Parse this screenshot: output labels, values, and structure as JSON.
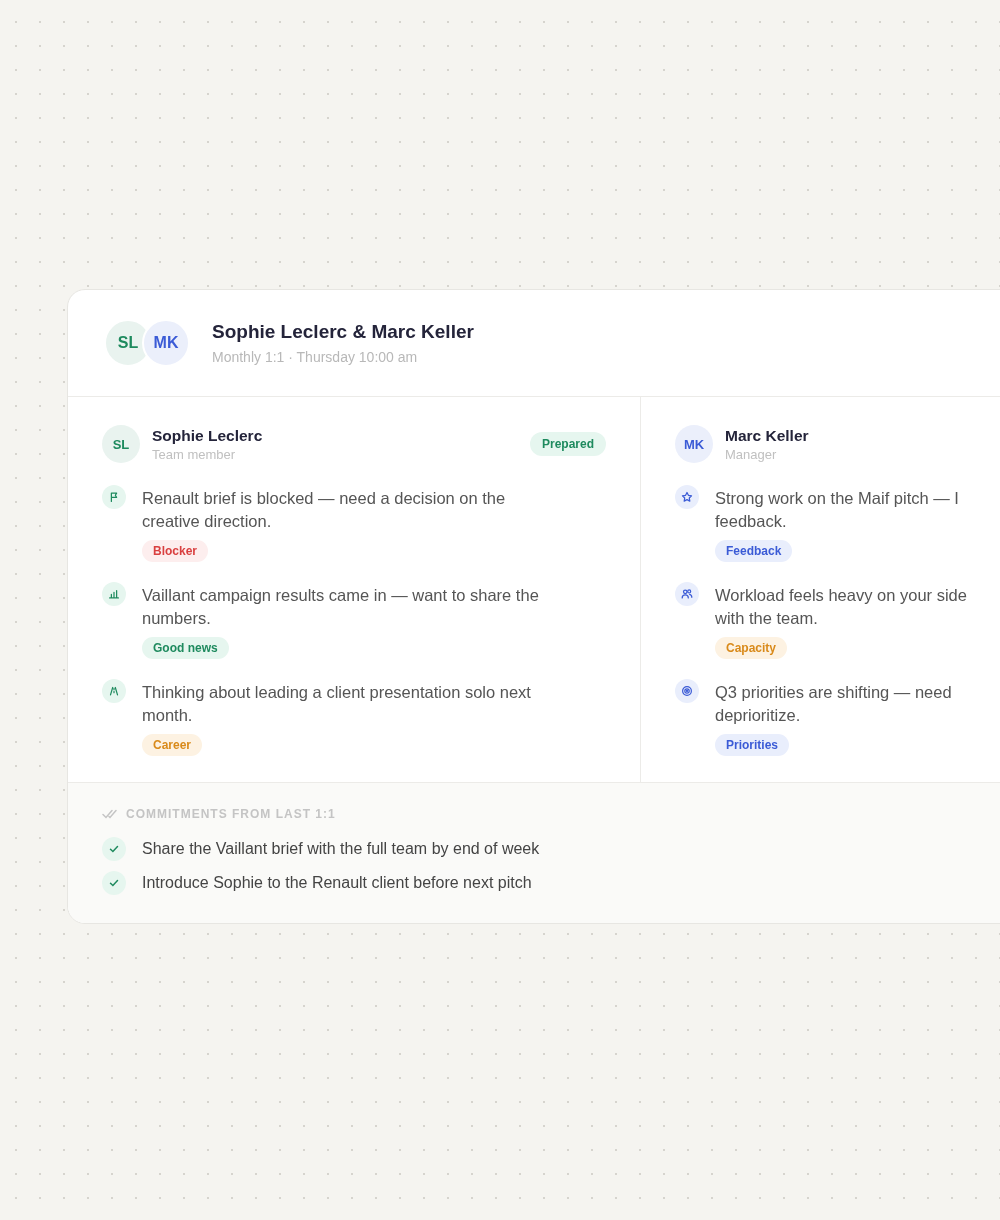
{
  "header": {
    "avatars": [
      {
        "initials": "SL",
        "color": "#1e8a5e"
      },
      {
        "initials": "MK",
        "color": "#3b5bd6"
      }
    ],
    "title": "Sophie Leclerc & Marc Keller",
    "subtitle": "Monthly 1:1 · Thursday 10:00 am"
  },
  "columns": [
    {
      "initials": "SL",
      "color": "#1e8a5e",
      "name": "Sophie Leclerc",
      "role": "Team member",
      "status": "Prepared",
      "items": [
        {
          "kind": "blocker",
          "lines": [
            "Renault brief is blocked — need a decision on the",
            "creative direction."
          ],
          "tag": "Blocker"
        },
        {
          "kind": "good-news",
          "lines": [
            "Vaillant campaign results came in — want to share the",
            "numbers."
          ],
          "tag": "Good news"
        },
        {
          "kind": "career",
          "lines": [
            "Thinking about leading a client presentation solo next",
            "month."
          ],
          "tag": "Career"
        }
      ]
    },
    {
      "initials": "MK",
      "color": "#3b5bd6",
      "name": "Marc Keller",
      "role": "Manager",
      "items": [
        {
          "kind": "feedback",
          "lines": [
            "Strong work on the Maif pitch — I",
            "feedback."
          ],
          "tag": "Feedback"
        },
        {
          "kind": "capacity",
          "lines": [
            "Workload feels heavy on your side",
            "with the team."
          ],
          "tag": "Capacity"
        },
        {
          "kind": "priorities",
          "lines": [
            "Q3 priorities are shifting — need",
            "deprioritize."
          ],
          "tag": "Priorities"
        }
      ]
    }
  ],
  "commitments": {
    "title": "COMMITMENTS FROM LAST 1:1",
    "items": [
      {
        "text": "Share the Vaillant brief with the full team by end of week",
        "checked": true
      },
      {
        "text": "Introduce Sophie to the Renault client before next pitch",
        "checked": true
      }
    ]
  }
}
